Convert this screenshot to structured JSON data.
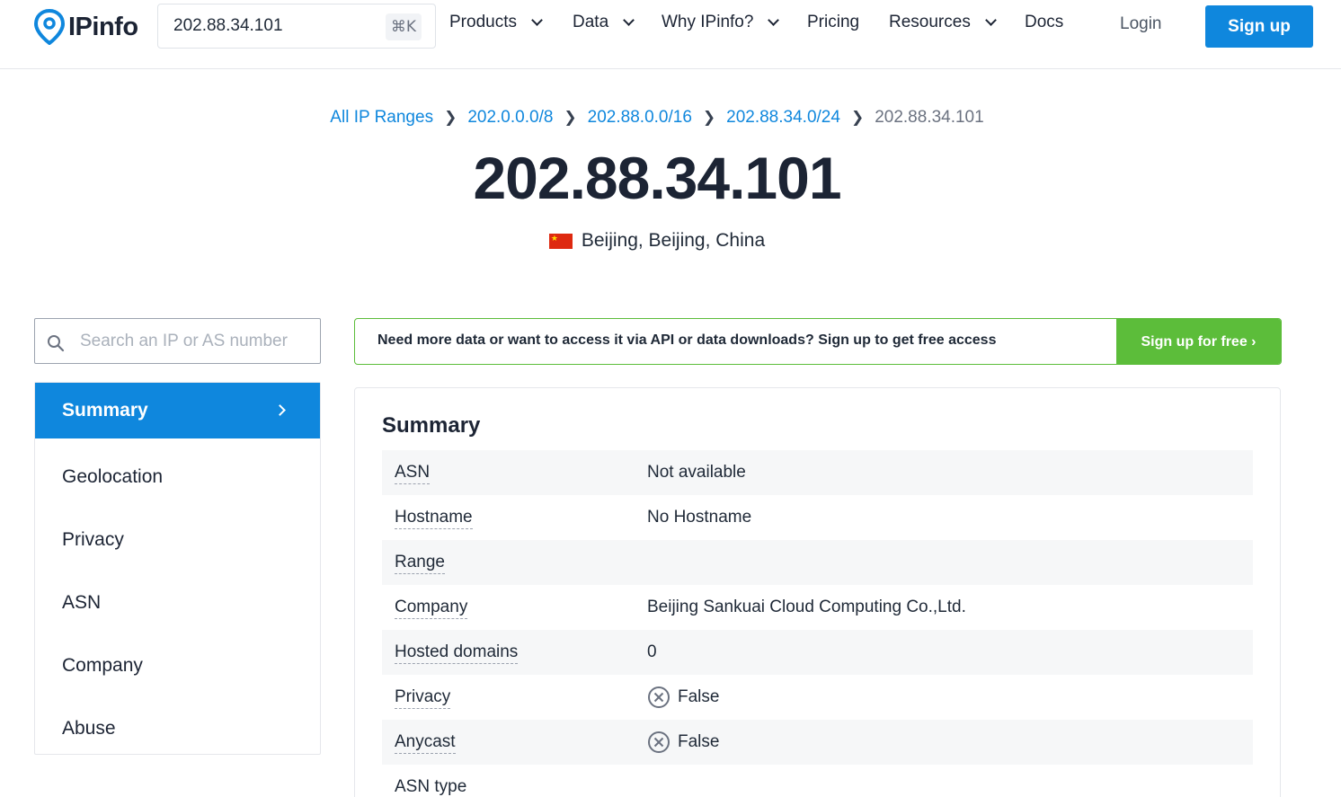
{
  "header": {
    "logo_text": "IPinfo",
    "search_value": "202.88.34.101",
    "shortcut": "⌘K",
    "nav": {
      "products": "Products",
      "data": "Data",
      "why": "Why IPinfo?",
      "pricing": "Pricing",
      "resources": "Resources",
      "docs": "Docs"
    },
    "login": "Login",
    "signup": "Sign up"
  },
  "breadcrumb": {
    "all": "All IP Ranges",
    "r8": "202.0.0.0/8",
    "r16": "202.88.0.0/16",
    "r24": "202.88.34.0/24",
    "current": "202.88.34.101"
  },
  "hero": {
    "ip": "202.88.34.101",
    "location": "Beijing, Beijing, China",
    "flag_icon": "china-flag-icon"
  },
  "sidebar": {
    "search_placeholder": "Search an IP or AS number",
    "items": [
      "Summary",
      "Geolocation",
      "Privacy",
      "ASN",
      "Company",
      "Abuse"
    ],
    "active": "Summary"
  },
  "banner": {
    "text": "Need more data or want to access it via API or data downloads? Sign up to get free access",
    "button": "Sign up for free ›"
  },
  "summary": {
    "title": "Summary",
    "rows": [
      {
        "key": "ASN",
        "value": "Not available"
      },
      {
        "key": "Hostname",
        "value": "No Hostname"
      },
      {
        "key": "Range",
        "value": ""
      },
      {
        "key": "Company",
        "value": "Beijing Sankuai Cloud Computing Co.,Ltd."
      },
      {
        "key": "Hosted domains",
        "value": "0"
      },
      {
        "key": "Privacy",
        "value": "False",
        "icon": "x-circle-icon"
      },
      {
        "key": "Anycast",
        "value": "False",
        "icon": "x-circle-icon"
      },
      {
        "key": "ASN type",
        "value": ""
      }
    ]
  },
  "colors": {
    "brand_blue": "#0f87dd",
    "cta_green": "#5cbd3a",
    "dark_text": "#1c2434"
  }
}
